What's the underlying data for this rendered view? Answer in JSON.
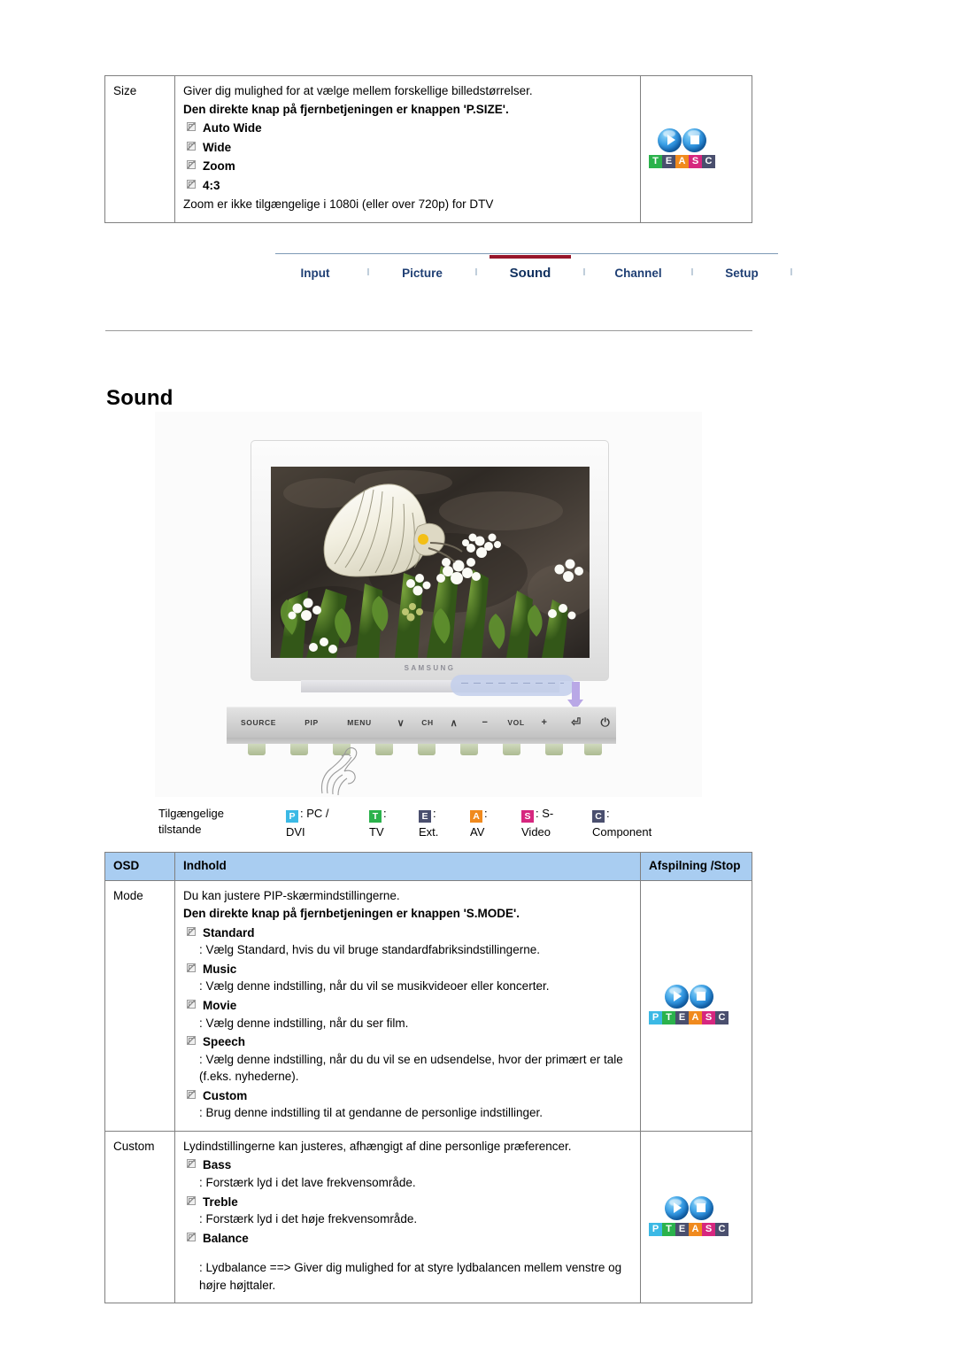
{
  "top_table": {
    "osd_label": "Size",
    "lead": "Giver dig mulighed for at vælge mellem forskellige billedstørrelser.",
    "direct_key_note": "Den direkte knap på fjernbetjeningen er knappen 'P.SIZE'.",
    "options": [
      "Auto Wide",
      "Wide",
      "Zoom",
      "4:3"
    ],
    "footnote": "Zoom er ikke tilgængelige i 1080i (eller over 720p) for DTV",
    "badge_letters": [
      "T",
      "E",
      "A",
      "S",
      "C"
    ]
  },
  "nav": {
    "tabs": [
      {
        "label": "Input",
        "active": false
      },
      {
        "label": "Picture",
        "active": false
      },
      {
        "label": "Sound",
        "active": true
      },
      {
        "label": "Channel",
        "active": false
      },
      {
        "label": "Setup",
        "active": false
      }
    ],
    "separator": "l"
  },
  "section": {
    "title": "Sound"
  },
  "illustration": {
    "brand": "SAMSUNG",
    "controls": [
      "SOURCE",
      "PIP",
      "MENU",
      "∨",
      "CH",
      "∧",
      "−",
      "VOL",
      "+",
      "⏎",
      "⏻"
    ]
  },
  "legend": {
    "title_line1": "Tilgængelige",
    "title_line2": "tilstande",
    "modes": [
      {
        "key": "P",
        "color": "#3bb9e5",
        "line1": ": PC /",
        "line2": "DVI"
      },
      {
        "key": "T",
        "color": "#2bb24c",
        "line1": ":",
        "line2": "TV"
      },
      {
        "key": "E",
        "color": "#4a4f6e",
        "line1": ":",
        "line2": "Ext."
      },
      {
        "key": "A",
        "color": "#f08a1e",
        "line1": ":",
        "line2": "AV"
      },
      {
        "key": "S",
        "color": "#d6277f",
        "line1": ": S-",
        "line2": "Video"
      },
      {
        "key": "C",
        "color": "#4a4f6e",
        "line1": ":",
        "line2": "Component"
      }
    ]
  },
  "bottom_table": {
    "headers": {
      "osd": "OSD",
      "content": "Indhold",
      "playstop": "Afspilning /Stop"
    },
    "rows": [
      {
        "osd": "Mode",
        "lead": "Du kan justere PIP-skærmindstillingerne.",
        "direct_key_note": "Den direkte knap på fjernbetjeningen er knappen 'S.MODE'.",
        "items": [
          {
            "name": "Standard",
            "desc": ": Vælg Standard, hvis du vil bruge standardfabriksindstillingerne."
          },
          {
            "name": "Music",
            "desc": ": Vælg denne indstilling, når du vil se musikvideoer eller koncerter."
          },
          {
            "name": "Movie",
            "desc": ": Vælg denne indstilling, når du ser film."
          },
          {
            "name": "Speech",
            "desc": ": Vælg denne indstilling, når du du vil se en udsendelse, hvor der primært er tale (f.eks. nyhederne)."
          },
          {
            "name": "Custom",
            "desc": ": Brug denne indstilling til at gendanne de personlige indstillinger."
          }
        ],
        "badge_letters": [
          "P",
          "T",
          "E",
          "A",
          "S",
          "C"
        ]
      },
      {
        "osd": "Custom",
        "lead": "Lydindstillingerne kan justeres, afhængigt af dine personlige præferencer.",
        "direct_key_note": "",
        "items": [
          {
            "name": "Bass",
            "desc": ": Forstærk lyd i det lave frekvensområde."
          },
          {
            "name": "Treble",
            "desc": ": Forstærk lyd i det høje frekvensområde."
          },
          {
            "name": "Balance",
            "desc": ": Lydbalance ==> Giver dig mulighed for at styre lydbalancen mellem venstre og højre højttaler."
          }
        ],
        "badge_letters": [
          "P",
          "T",
          "E",
          "A",
          "S",
          "C"
        ]
      }
    ]
  },
  "badge_colors": {
    "P": "#3bb9e5",
    "T": "#2bb24c",
    "E": "#4a4f6e",
    "A": "#f08a1e",
    "S": "#d6277f",
    "C": "#4a4f6e"
  }
}
